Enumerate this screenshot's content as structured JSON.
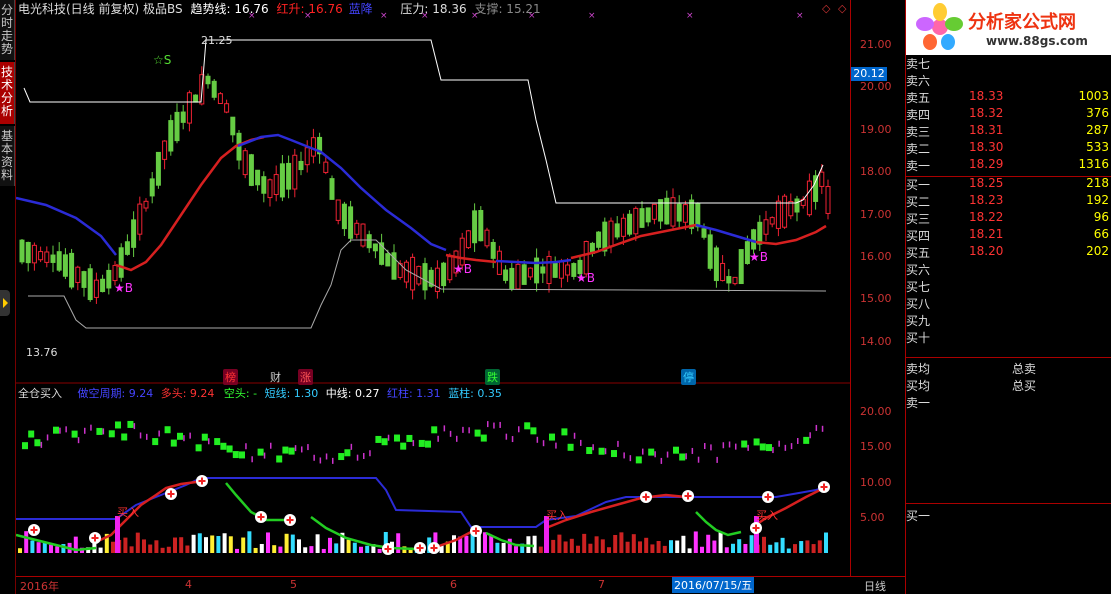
{
  "sidebar": {
    "tabs": [
      {
        "label": "分时走势",
        "active": false
      },
      {
        "label": "技术分析",
        "active": true
      },
      {
        "label": "基本资料",
        "active": false
      }
    ]
  },
  "main_header": {
    "title": "电光科技(日线 前复权) 极品BS",
    "trend_label": "趋势线: 16.76",
    "red_rise": "红升: 16.76",
    "blue_fall": "蓝降",
    "pressure": "压力: 18.36",
    "support": "支撑: 15.21"
  },
  "price_axis": [
    "21.00",
    "20.00",
    "19.00",
    "18.00",
    "17.00",
    "16.00",
    "15.00",
    "14.00"
  ],
  "price_box": "20.12",
  "annotations": {
    "high": "21.25",
    "low": "13.76",
    "signals": [
      "☆S",
      "★B",
      "★B",
      "★B",
      "★B"
    ]
  },
  "events": [
    "榜",
    "财",
    "涨",
    "跌",
    "停"
  ],
  "sub_header": {
    "title": "全仓买入",
    "bull_bear_period": "做空周期: 9.24",
    "bull": "多头: 9.24",
    "bear": "空头: -",
    "short_line": "短线: 1.30",
    "mid_line": "中线: 0.27",
    "red_bar": "红柱: 1.31",
    "blue_bar": "蓝柱: 0.35"
  },
  "sub_axis": [
    "20.00",
    "15.00",
    "10.00",
    "5.00"
  ],
  "buy_label": "买入",
  "x_axis": [
    "2016年",
    "4",
    "5",
    "6",
    "7"
  ],
  "x_cursor": "2016/07/15/五",
  "period": "日线",
  "logo": {
    "text": "分析家公式网",
    "url": "www.88gs.com"
  },
  "orderbook": {
    "rows": [
      {
        "label": "卖七",
        "price": "",
        "vol": ""
      },
      {
        "label": "卖六",
        "price": "",
        "vol": ""
      },
      {
        "label": "卖五",
        "price": "18.33",
        "vol": "1003"
      },
      {
        "label": "卖四",
        "price": "18.32",
        "vol": "376"
      },
      {
        "label": "卖三",
        "price": "18.31",
        "vol": "287"
      },
      {
        "label": "卖二",
        "price": "18.30",
        "vol": "533"
      },
      {
        "label": "卖一",
        "price": "18.29",
        "vol": "1316"
      },
      {
        "label": "买一",
        "price": "18.25",
        "vol": "218"
      },
      {
        "label": "买二",
        "price": "18.23",
        "vol": "192"
      },
      {
        "label": "买三",
        "price": "18.22",
        "vol": "96"
      },
      {
        "label": "买四",
        "price": "18.21",
        "vol": "66"
      },
      {
        "label": "买五",
        "price": "18.20",
        "vol": "202"
      },
      {
        "label": "买六",
        "price": "",
        "vol": ""
      },
      {
        "label": "买七",
        "price": "",
        "vol": ""
      },
      {
        "label": "买八",
        "price": "",
        "vol": ""
      },
      {
        "label": "买九",
        "price": "",
        "vol": ""
      },
      {
        "label": "买十",
        "price": "",
        "vol": ""
      }
    ],
    "avg": [
      {
        "label": "卖均",
        "value": "总卖"
      },
      {
        "label": "买均",
        "value": "总买"
      }
    ],
    "extra_sell": "卖一",
    "extra_buy": "买一"
  },
  "colors": {
    "up": "#ff3333",
    "down": "#66dd44",
    "trend_red": "#dd2222",
    "trend_blue": "#2222dd",
    "axis": "#aa0000"
  }
}
